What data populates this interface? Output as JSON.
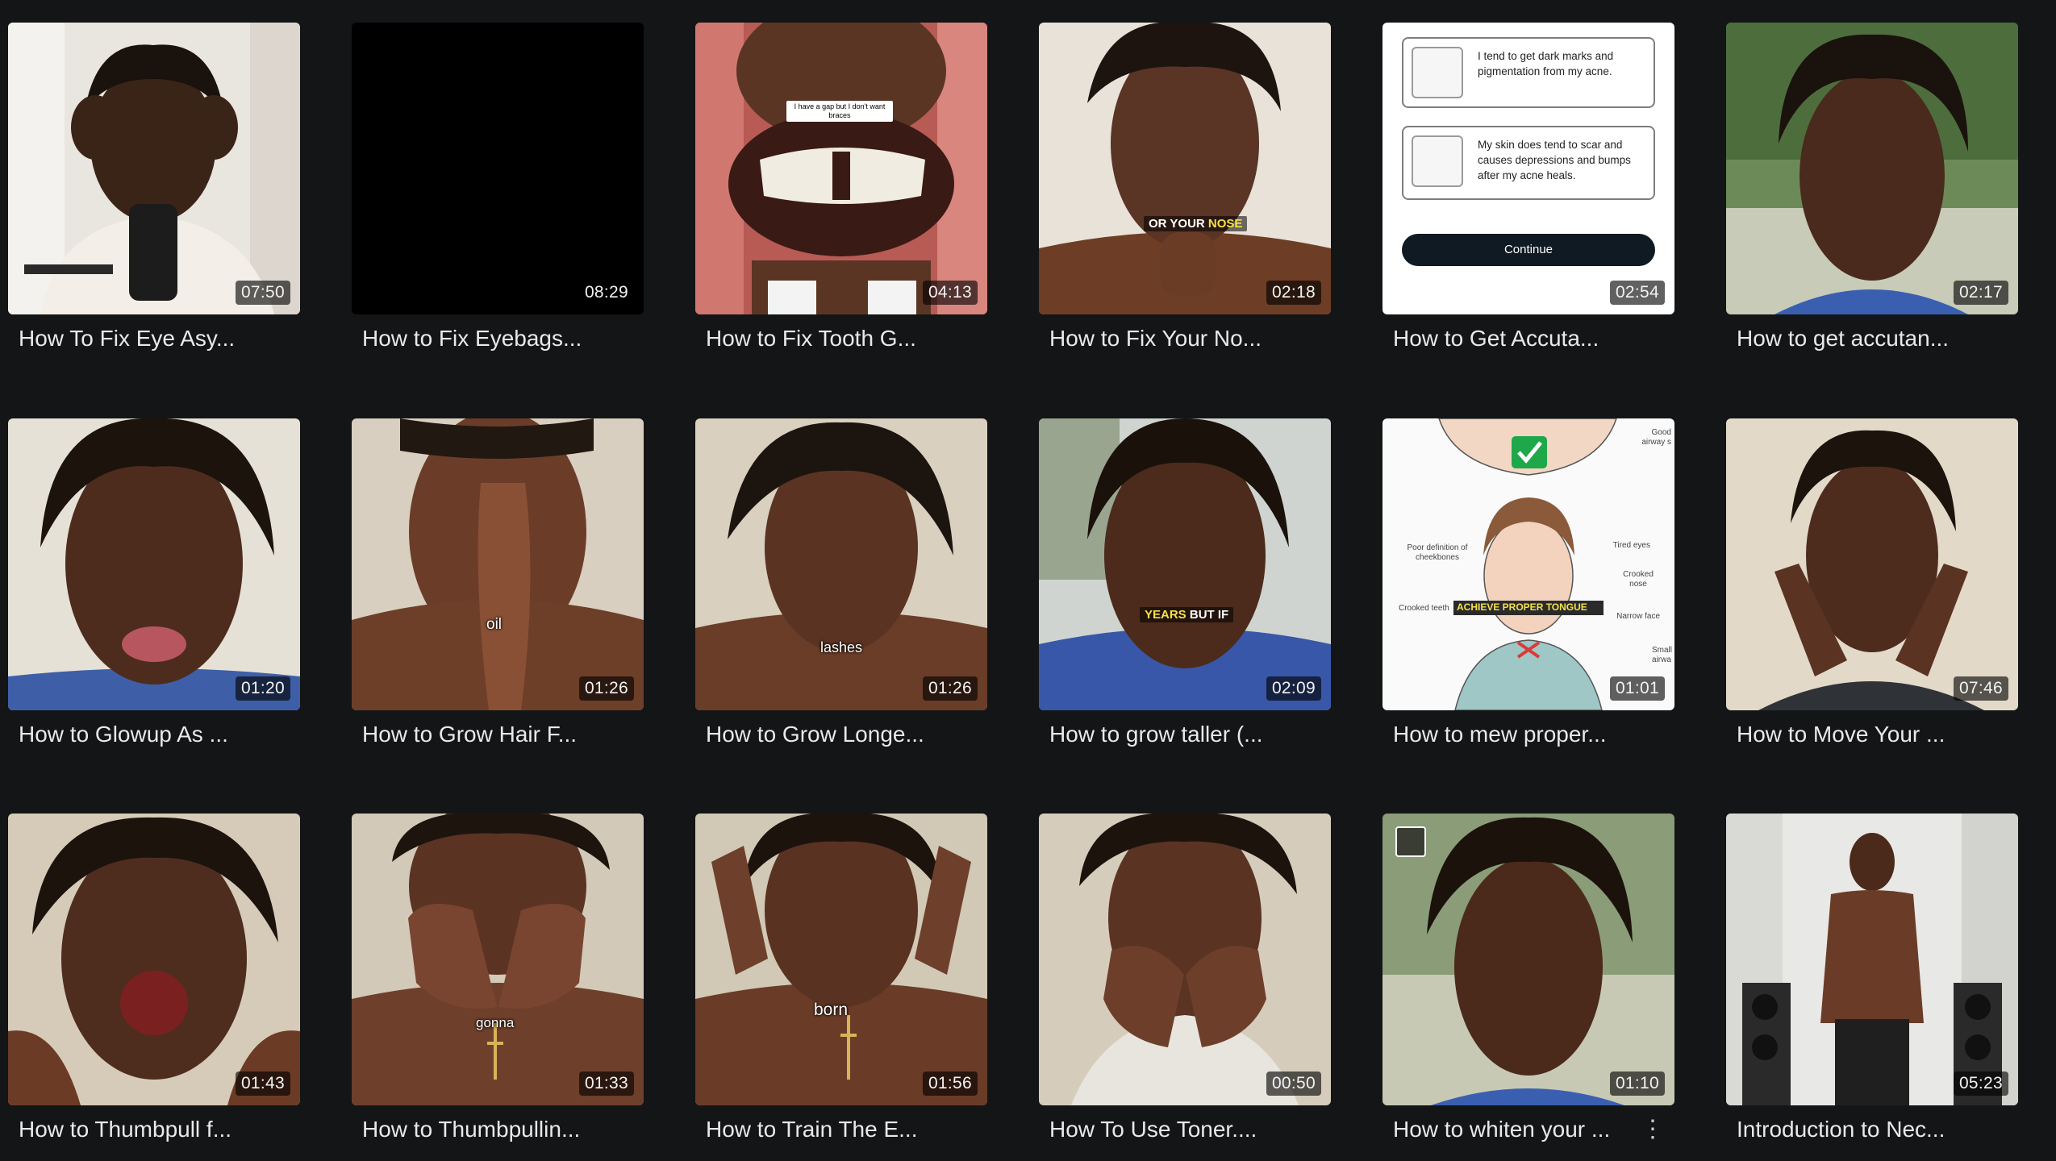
{
  "videos": [
    {
      "title": "How To Fix Eye Asy...",
      "duration": "07:50"
    },
    {
      "title": "How to Fix Eyebags...",
      "duration": "08:29"
    },
    {
      "title": "How to Fix Tooth G...",
      "duration": "04:13",
      "overlay_text": "I have a gap but I don't want braces"
    },
    {
      "title": "How to Fix Your No...",
      "duration": "02:18",
      "caption_a": "OR YOUR ",
      "caption_b": "NOSE"
    },
    {
      "title": "How to Get Accuta...",
      "duration": "02:54",
      "quiz": {
        "option1": "I tend to get dark marks and pigmentation from my acne.",
        "option2": "My skin does tend to scar and causes depressions and bumps after my acne heals.",
        "button": "Continue"
      }
    },
    {
      "title": "How to get accutan...",
      "duration": "02:17"
    },
    {
      "title": "How to Glowup As ...",
      "duration": "01:20"
    },
    {
      "title": "How to Grow Hair F...",
      "duration": "01:26",
      "subtitle": "oil"
    },
    {
      "title": "How to Grow Longe...",
      "duration": "01:26",
      "subtitle": "lashes"
    },
    {
      "title": "How to grow taller (...",
      "duration": "02:09",
      "caption_a": "YEARS",
      "caption_b": " BUT IF"
    },
    {
      "title": "How to mew proper...",
      "duration": "01:01",
      "diagram": {
        "good": "Good airway s",
        "poor_cheek": "Poor definition of cheekbones",
        "tired": "Tired eyes",
        "crooked_nose": "Crooked nose",
        "crooked_teeth": "Crooked teeth",
        "narrow": "Narrow face",
        "small": "Small airwa",
        "banner": "ACHIEVE PROPER TONGUE"
      }
    },
    {
      "title": "How to Move Your ...",
      "duration": "07:46"
    },
    {
      "title": "How to Thumbpull f...",
      "duration": "01:43"
    },
    {
      "title": "How to Thumbpullin...",
      "duration": "01:33",
      "subtitle": "gonna"
    },
    {
      "title": "How to Train The E...",
      "duration": "01:56",
      "subtitle": "born"
    },
    {
      "title": "How To Use Toner....",
      "duration": "00:50"
    },
    {
      "title": "How to whiten your ...",
      "duration": "01:10",
      "menu_icon": "kebab-menu-icon",
      "checkbox_icon": "select-checkbox-icon"
    },
    {
      "title": "Introduction to Nec...",
      "duration": "05:23"
    }
  ],
  "colors": {
    "background": "#131516",
    "title_text": "#e9e9e9",
    "duration_bg": "rgba(0,0,0,0.62)",
    "caption_highlight": "#f5e14a"
  }
}
